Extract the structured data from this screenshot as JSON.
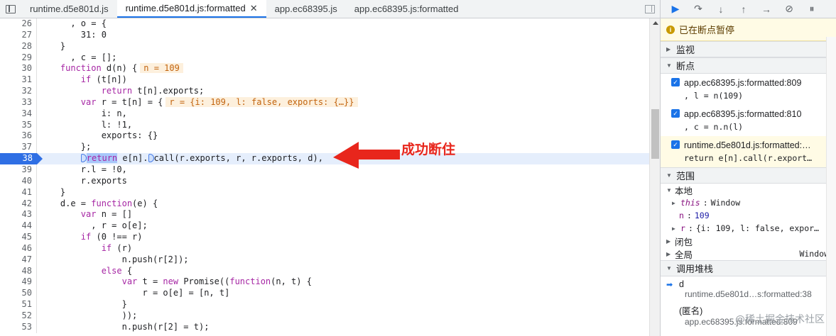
{
  "tabs": [
    {
      "label": "runtime.d5e801d.js",
      "active": false,
      "closable": false
    },
    {
      "label": "runtime.d5e801d.js:formatted",
      "active": true,
      "closable": true
    },
    {
      "label": "app.ec68395.js",
      "active": false,
      "closable": false
    },
    {
      "label": "app.ec68395.js:formatted",
      "active": false,
      "closable": false
    }
  ],
  "close_glyph": "✕",
  "code_lines": [
    {
      "n": "26",
      "text": "      , o = {"
    },
    {
      "n": "27",
      "text": "        31: 0"
    },
    {
      "n": "28",
      "text": "    }"
    },
    {
      "n": "29",
      "text": "      , c = [];"
    },
    {
      "n": "30",
      "text": "    function d(n) {",
      "inline": "n = 109"
    },
    {
      "n": "31",
      "text": "        if (t[n])"
    },
    {
      "n": "32",
      "text": "            return t[n].exports;"
    },
    {
      "n": "33",
      "text": "        var r = t[n] = {",
      "inline": "r = {i: 109, l: false, exports: {…}}"
    },
    {
      "n": "34",
      "text": "            i: n,"
    },
    {
      "n": "35",
      "text": "            l: !1,"
    },
    {
      "n": "36",
      "text": "            exports: {}"
    },
    {
      "n": "37",
      "text": "        };"
    },
    {
      "n": "38",
      "text": "",
      "breakpoint": true
    },
    {
      "n": "39",
      "text": "        r.l = !0,"
    },
    {
      "n": "40",
      "text": "        r.exports"
    },
    {
      "n": "41",
      "text": "    }"
    },
    {
      "n": "42",
      "text": "    d.e = function(e) {"
    },
    {
      "n": "43",
      "text": "        var n = []"
    },
    {
      "n": "44",
      "text": "          , r = o[e];"
    },
    {
      "n": "45",
      "text": "        if (0 !== r)"
    },
    {
      "n": "46",
      "text": "            if (r)"
    },
    {
      "n": "47",
      "text": "                n.push(r[2]);"
    },
    {
      "n": "48",
      "text": "            else {"
    },
    {
      "n": "49",
      "text": "                var t = new Promise((function(n, t) {"
    },
    {
      "n": "50",
      "text": "                    r = o[e] = [n, t]"
    },
    {
      "n": "51",
      "text": "                }"
    },
    {
      "n": "52",
      "text": "                ));"
    },
    {
      "n": "53",
      "text": "                n.push(r[2] = t);"
    }
  ],
  "bp_line": {
    "indent": "        ",
    "keyword": "return",
    "mid": " e[n].",
    "rest": "call(r.exports, r, r.exports, d),"
  },
  "annotation": {
    "text": "成功断住",
    "color": "#e8261c"
  },
  "debug_toolbar": {
    "resume_icon": "▶",
    "step_over_icon": "↷",
    "step_into_icon": "↓",
    "step_out_icon": "↑",
    "step_icon": "→",
    "deactivate_icon": "⊘",
    "pause_exceptions_icon": "⏸"
  },
  "paused_banner": "已在断点暂停",
  "sections": {
    "watch": "监视",
    "breakpoints": "断点",
    "scope": "范围",
    "callstack": "调用堆栈"
  },
  "breakpoints": [
    {
      "file": "app.ec68395.js:formatted:809",
      "code": ", l = n(109)",
      "current": false
    },
    {
      "file": "app.ec68395.js:formatted:810",
      "code": ", c = n.n(l)",
      "current": false
    },
    {
      "file": "runtime.d5e801d.js:formatted:…",
      "code": "return e[n].call(r.export…",
      "current": true
    }
  ],
  "scope": {
    "local_label": "本地",
    "this_key": "this",
    "this_val": "Window",
    "n_key": "n",
    "n_val": "109",
    "r_key": "r",
    "r_val": "{i: 109, l: false, expor…",
    "closure_label": "闭包",
    "global_label": "全局",
    "global_val": "Window"
  },
  "callstack": [
    {
      "fn": "d",
      "loc": "runtime.d5e801d…s:formatted:38",
      "current": true
    },
    {
      "fn": "(匿名)",
      "loc": "app.ec68395.js:formatted:809",
      "current": false
    }
  ],
  "watermark": "@稀土掘金技术社区"
}
